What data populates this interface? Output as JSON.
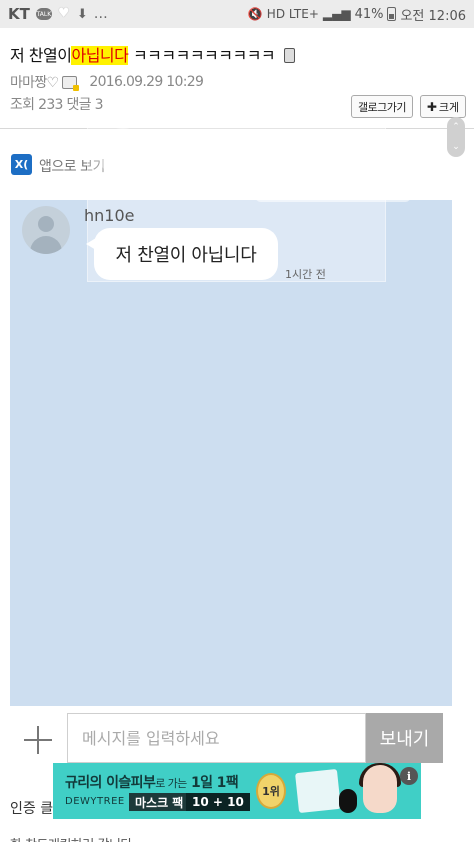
{
  "status_bar": {
    "carrier": "KT",
    "talk_badge": "TALK",
    "overflow": "…",
    "network": "HD LTE+",
    "battery": "41%",
    "time": "오전 12:06"
  },
  "post": {
    "title_prefix": "저 찬열이",
    "title_highlight": "아닙니다",
    "title_suffix": " ㅋㅋㅋㅋㅋㅋㅋㅋㅋㅋ",
    "author": "마마짱♡",
    "date": "2016.09.29 10:29",
    "stats": "조회 233  댓글 3",
    "gallery_button": "갤로그가기",
    "zoom_button": "크게"
  },
  "app_view": {
    "icon_label": "X(",
    "text": "앱으로 보기"
  },
  "chat": {
    "username": "hn10e",
    "message": "저 찬열이 아닙니다",
    "timestamp": "1시간 전",
    "input_placeholder": "메시지를 입력하세요",
    "send_label": "보내기"
  },
  "ad": {
    "headline": "규리의 이슬피부",
    "headline_small": "로 가는",
    "headline_tail": "1일 1팩",
    "brand": "DEWYTREE",
    "tag": "마스크 팩",
    "tag2": "10 + 10",
    "medal": "1위",
    "info": "i"
  },
  "footer": {
    "cert_text": "인증 클",
    "bottom_text": "화 찬드래킹하러 갑니다"
  },
  "colors": {
    "highlight_bg": "#fff200",
    "highlight_text": "#e00000",
    "chat_bg": "#cddef0",
    "ad_bg": "#40cfc6",
    "send_button": "#a9a9a9"
  }
}
